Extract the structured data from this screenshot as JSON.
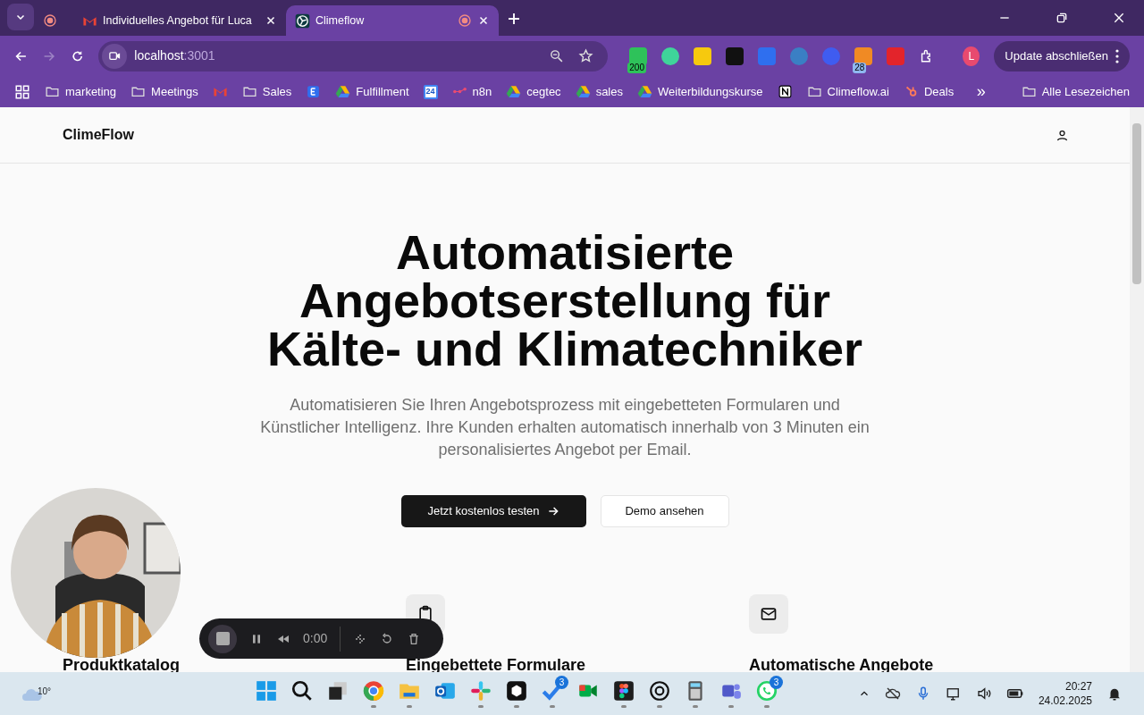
{
  "browser": {
    "tabs": [
      {
        "kind": "pinned",
        "selected": false,
        "recording": true
      },
      {
        "kind": "gmail",
        "title": "Individuelles Angebot für Luca",
        "selected": false,
        "recording": false
      },
      {
        "kind": "site",
        "title": "Climeflow",
        "selected": true,
        "recording": true
      }
    ],
    "address": {
      "host": "localhost",
      "port": ":3001"
    },
    "extensions": [
      {
        "kind": "green",
        "badge": "200"
      },
      {
        "kind": "mint"
      },
      {
        "kind": "yellow"
      },
      {
        "kind": "black"
      },
      {
        "kind": "blue"
      },
      {
        "kind": "globe"
      },
      {
        "kind": "spark"
      },
      {
        "kind": "orange",
        "badge": "28"
      },
      {
        "kind": "red"
      }
    ],
    "profile": "L",
    "update_button": "Update abschließen",
    "bookmarks": [
      {
        "kind": "folder",
        "label": "marketing"
      },
      {
        "kind": "folder",
        "label": "Meetings"
      },
      {
        "kind": "gmail"
      },
      {
        "kind": "folder",
        "label": "Sales"
      },
      {
        "kind": "app"
      },
      {
        "kind": "drive",
        "label": "Fulfillment"
      },
      {
        "kind": "calendar",
        "icon_text": "24"
      },
      {
        "kind": "n8n",
        "label": "n8n"
      },
      {
        "kind": "drive",
        "label": "cegtec"
      },
      {
        "kind": "drive",
        "label": "sales"
      },
      {
        "kind": "drive",
        "label": "Weiterbildungskurse"
      },
      {
        "kind": "notion"
      },
      {
        "kind": "folder",
        "label": "Climeflow.ai"
      },
      {
        "kind": "hubspot",
        "label": "Deals"
      }
    ],
    "overflow": "»",
    "all_bookmarks": "Alle Lesezeichen"
  },
  "page": {
    "brand": "ClimeFlow",
    "hero_title": "Automatisierte Angebotserstellung für Kälte- und Klimatechniker",
    "hero_text": "Automatisieren Sie Ihren Angebotsprozess mit eingebetteten Formularen und Künstlicher Intelligenz. Ihre Kunden erhalten automatisch innerhalb von 3 Minuten ein personalisiertes Angebot per Email.",
    "buttons": [
      {
        "kind": "primary",
        "label": "Jetzt kostenlos testen"
      },
      {
        "kind": "outline",
        "label": "Demo ansehen"
      }
    ],
    "features": [
      {
        "title": "Produktkatalog"
      },
      {
        "title": "Eingebettete Formulare"
      },
      {
        "title": "Automatische Angebote"
      }
    ]
  },
  "recorder": {
    "time": "0:00"
  },
  "taskbar": {
    "weather": "10°",
    "apps": [
      {
        "kind": "start",
        "running": false
      },
      {
        "kind": "search",
        "running": false
      },
      {
        "kind": "taskview",
        "running": false
      },
      {
        "kind": "chrome",
        "running": true
      },
      {
        "kind": "explorer",
        "running": true
      },
      {
        "kind": "outlook",
        "running": false
      },
      {
        "kind": "slack",
        "running": true
      },
      {
        "kind": "cube",
        "running": true
      },
      {
        "kind": "todo",
        "running": true,
        "badge": "3"
      },
      {
        "kind": "meet",
        "running": false
      },
      {
        "kind": "figma",
        "running": true
      },
      {
        "kind": "chatgpt",
        "running": true
      },
      {
        "kind": "calc",
        "running": true
      },
      {
        "kind": "teams",
        "running": true
      },
      {
        "kind": "whatsapp",
        "running": true,
        "badge": "3"
      }
    ],
    "time": "20:27",
    "date": "24.02.2025"
  }
}
